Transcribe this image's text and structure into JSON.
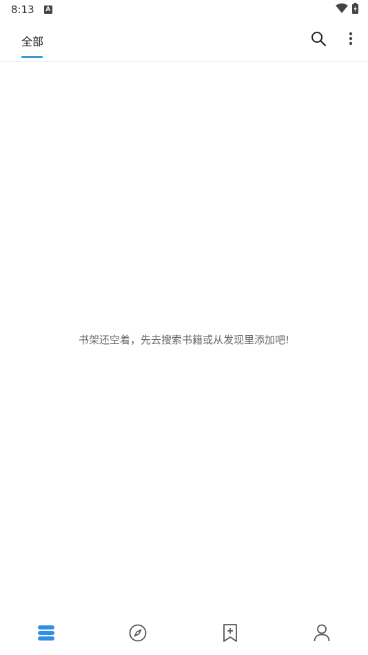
{
  "status_bar": {
    "time": "8:13",
    "notification_badge": "A",
    "icons": [
      "wifi-icon",
      "battery-charging-icon"
    ]
  },
  "app_bar": {
    "tabs": [
      {
        "label": "全部",
        "selected": true
      }
    ],
    "actions": [
      "search-icon",
      "more-vert-icon"
    ],
    "accent_color": "#3a9ad9"
  },
  "main": {
    "empty_message": "书架还空着，先去搜索书籍或从发现里添加吧!"
  },
  "bottom_nav": {
    "items": [
      {
        "icon": "bookshelf-icon",
        "selected": true
      },
      {
        "icon": "compass-icon",
        "selected": false
      },
      {
        "icon": "bookmark-add-icon",
        "selected": false
      },
      {
        "icon": "person-icon",
        "selected": false
      }
    ],
    "selected_color": "#2f8fe6",
    "unselected_color": "#555555"
  }
}
